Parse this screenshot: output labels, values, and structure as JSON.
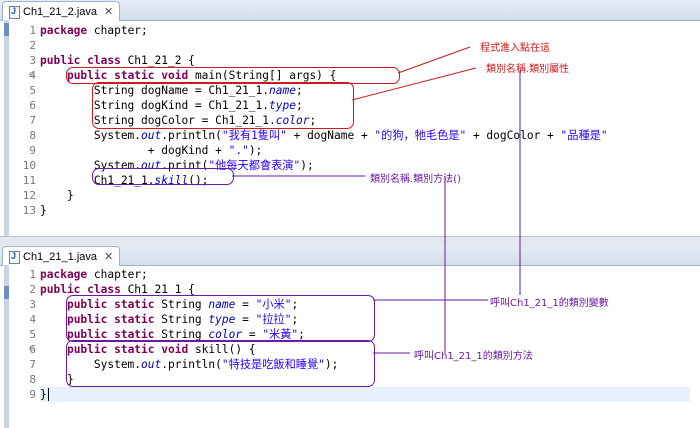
{
  "editors": [
    {
      "tab_title": "Ch1_21_2.java",
      "tab_close": "✕",
      "lines": [
        {
          "n": "1",
          "segs": [
            [
              "kw",
              "package"
            ],
            [
              "t",
              " chapter;"
            ]
          ]
        },
        {
          "n": "2",
          "segs": []
        },
        {
          "n": "3",
          "segs": [
            [
              "kw",
              "public class"
            ],
            [
              "t",
              " Ch1_21_2 {"
            ]
          ]
        },
        {
          "n": "4",
          "fold": true,
          "segs": [
            [
              "t",
              "    "
            ],
            [
              "kw",
              "public static void"
            ],
            [
              "t",
              " main(String[] args) {"
            ]
          ]
        },
        {
          "n": "5",
          "segs": [
            [
              "t",
              "        String dogName = Ch1_21_1."
            ],
            [
              "fld",
              "name"
            ],
            [
              "t",
              ";"
            ]
          ]
        },
        {
          "n": "6",
          "segs": [
            [
              "t",
              "        String dogKind = Ch1_21_1."
            ],
            [
              "fld",
              "type"
            ],
            [
              "t",
              ";"
            ]
          ]
        },
        {
          "n": "7",
          "segs": [
            [
              "t",
              "        String dogColor = Ch1_21_1."
            ],
            [
              "fld",
              "color"
            ],
            [
              "t",
              ";"
            ]
          ]
        },
        {
          "n": "8",
          "segs": [
            [
              "t",
              "        System."
            ],
            [
              "fld",
              "out"
            ],
            [
              "t",
              ".println("
            ],
            [
              "str",
              "\"我有1隻叫\""
            ],
            [
              "t",
              " + dogName + "
            ],
            [
              "str",
              "\"的狗，牠毛色是\""
            ],
            [
              "t",
              " + dogColor + "
            ],
            [
              "str",
              "\"品種是\""
            ]
          ]
        },
        {
          "n": "9",
          "segs": [
            [
              "t",
              "                + dogKind + "
            ],
            [
              "str",
              "\".\""
            ],
            [
              "t",
              ");"
            ]
          ]
        },
        {
          "n": "10",
          "segs": [
            [
              "t",
              "        System."
            ],
            [
              "fld",
              "out"
            ],
            [
              "t",
              ".print("
            ],
            [
              "str",
              "\"他每天都會表演\""
            ],
            [
              "t",
              ");"
            ]
          ]
        },
        {
          "n": "11",
          "segs": [
            [
              "t",
              "        Ch1_21_1."
            ],
            [
              "fld",
              "skill"
            ],
            [
              "t",
              "();"
            ]
          ]
        },
        {
          "n": "12",
          "segs": [
            [
              "t",
              "    }"
            ]
          ]
        },
        {
          "n": "13",
          "segs": [
            [
              "t",
              "}"
            ]
          ]
        }
      ]
    },
    {
      "tab_title": "Ch1_21_1.java",
      "tab_close": "✕",
      "lines": [
        {
          "n": "1",
          "segs": [
            [
              "kw",
              "package"
            ],
            [
              "t",
              " chapter;"
            ]
          ]
        },
        {
          "n": "2",
          "segs": [
            [
              "kw",
              "public class"
            ],
            [
              "t",
              " Ch1_21_1 {"
            ]
          ]
        },
        {
          "n": "3",
          "segs": [
            [
              "t",
              "    "
            ],
            [
              "kw",
              "public static"
            ],
            [
              "t",
              " String "
            ],
            [
              "fld",
              "name"
            ],
            [
              "t",
              " = "
            ],
            [
              "str",
              "\"小米\""
            ],
            [
              "t",
              ";"
            ]
          ]
        },
        {
          "n": "4",
          "segs": [
            [
              "t",
              "    "
            ],
            [
              "kw",
              "public static"
            ],
            [
              "t",
              " String "
            ],
            [
              "fld",
              "type"
            ],
            [
              "t",
              " = "
            ],
            [
              "str",
              "\"拉拉\""
            ],
            [
              "t",
              ";"
            ]
          ]
        },
        {
          "n": "5",
          "segs": [
            [
              "t",
              "    "
            ],
            [
              "kw",
              "public static"
            ],
            [
              "t",
              " String "
            ],
            [
              "fld",
              "color"
            ],
            [
              "t",
              " = "
            ],
            [
              "str",
              "\"米黃\""
            ],
            [
              "t",
              ";"
            ]
          ]
        },
        {
          "n": "6",
          "fold": true,
          "segs": [
            [
              "t",
              "    "
            ],
            [
              "kw",
              "public static void"
            ],
            [
              "t",
              " skill() {"
            ]
          ]
        },
        {
          "n": "7",
          "segs": [
            [
              "t",
              "        System."
            ],
            [
              "fld",
              "out"
            ],
            [
              "t",
              ".println("
            ],
            [
              "str",
              "\"特技是吃飯和睡覺\""
            ],
            [
              "t",
              ");"
            ]
          ]
        },
        {
          "n": "8",
          "segs": [
            [
              "t",
              "    }"
            ]
          ]
        },
        {
          "n": "9",
          "segs": [
            [
              "t",
              "}"
            ]
          ]
        }
      ]
    }
  ],
  "annotations": {
    "entry_point": "程式進入點在這",
    "class_attr": "類別名稱.類別屬性",
    "class_method": "類別名稱.類別方法()",
    "call_vars": "呼叫Ch1_21_1的類別變數",
    "call_method": "呼叫Ch1_21_1的類別方法"
  },
  "colors": {
    "keyword": "#7f0055",
    "string": "#2a00ff",
    "field": "#0000c0",
    "annotation_red": "#cc1b1b",
    "annotation_purple": "#6a1aa8"
  }
}
